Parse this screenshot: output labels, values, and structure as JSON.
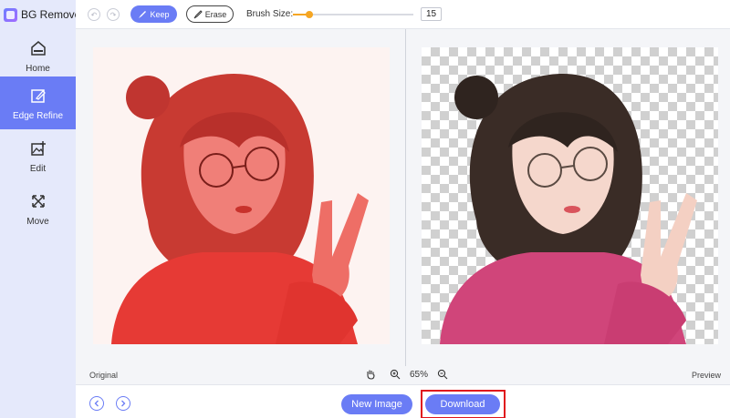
{
  "app": {
    "title": "BG Remover"
  },
  "sidebar": {
    "items": [
      {
        "label": "Home",
        "icon": "home-icon",
        "active": false
      },
      {
        "label": "Edge Refine",
        "icon": "edge-refine-icon",
        "active": true
      },
      {
        "label": "Edit",
        "icon": "edit-image-icon",
        "active": false
      },
      {
        "label": "Move",
        "icon": "move-icon",
        "active": false
      }
    ]
  },
  "toolbar": {
    "keep_label": "Keep",
    "erase_label": "Erase",
    "brush_size_label": "Brush Size:",
    "brush_size_value": "15",
    "brush_size_fraction": 0.14
  },
  "canvas": {
    "original_label": "Original",
    "preview_label": "Preview",
    "zoom_label": "65%"
  },
  "actions": {
    "new_image_label": "New Image",
    "download_label": "Download"
  },
  "colors": {
    "accent": "#6a7cf5",
    "slider": "#f5a623",
    "highlight": "#e0161c",
    "sidebar_bg": "#e5e9fb"
  }
}
